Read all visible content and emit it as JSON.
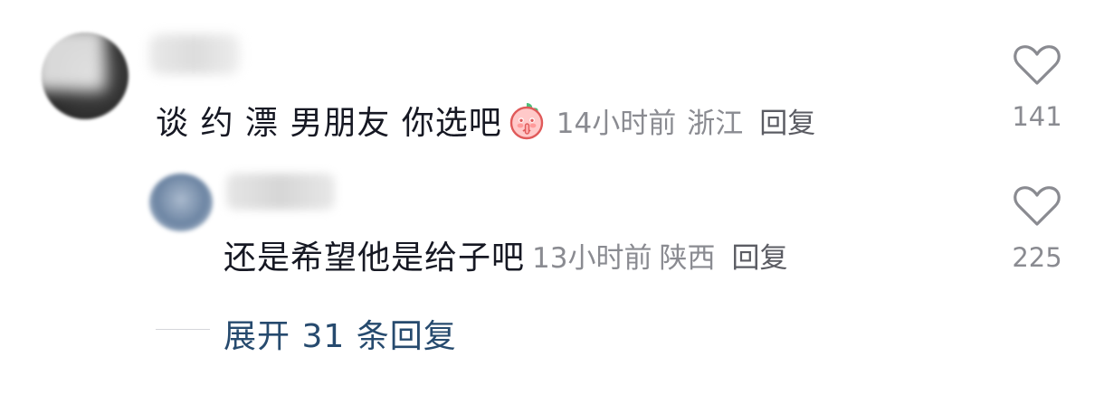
{
  "comment": {
    "text": "谈 约 漂 男朋友 你选吧",
    "emoji": "peach-shush-emoji",
    "time": "14小时前",
    "location": "浙江",
    "reply_label": "回复",
    "likes": "141"
  },
  "reply": {
    "text": "还是希望他是给子吧",
    "time": "13小时前",
    "location": "陕西",
    "reply_label": "回复",
    "likes": "225"
  },
  "expand": {
    "label": "展开 31 条回复"
  },
  "colors": {
    "text_primary": "#161823",
    "text_meta": "#8a8b91",
    "link_blue": "#264a6e"
  }
}
